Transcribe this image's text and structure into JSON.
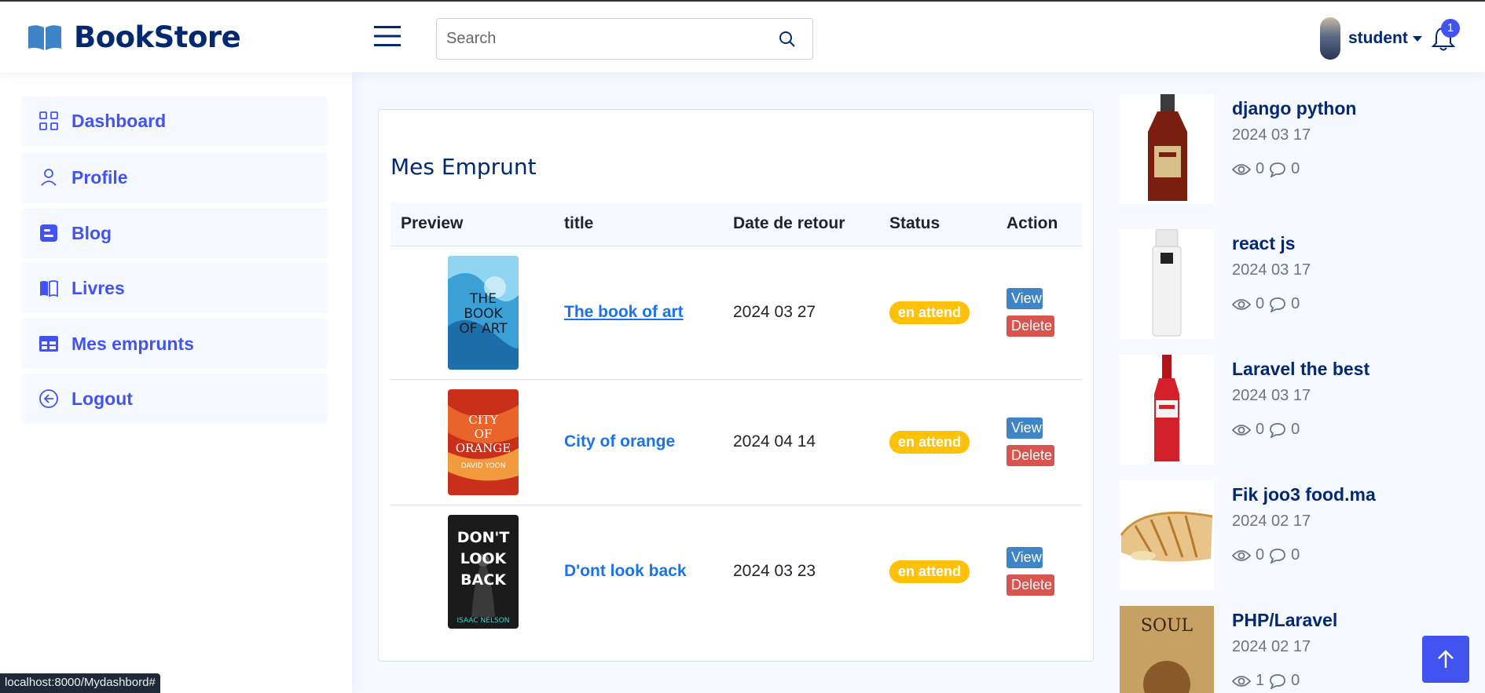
{
  "header": {
    "brand": "BookStore",
    "search_placeholder": "Search",
    "user_name": "student",
    "notification_count": "1"
  },
  "sidebar": {
    "items": [
      {
        "label": "Dashboard",
        "icon": "grid-icon"
      },
      {
        "label": "Profile",
        "icon": "person-icon"
      },
      {
        "label": "Blog",
        "icon": "blogger-icon"
      },
      {
        "label": "Livres",
        "icon": "book-icon"
      },
      {
        "label": "Mes emprunts",
        "icon": "table-icon"
      },
      {
        "label": "Logout",
        "icon": "arrow-left-circle-icon"
      }
    ]
  },
  "loans": {
    "title": "Mes Emprunt",
    "columns": [
      "Preview",
      "title",
      "Date de retour",
      "Status",
      "Action"
    ],
    "rows": [
      {
        "title": "The book of art",
        "date": "2024 03 27",
        "status": "en attend",
        "view": "View",
        "delete": "Delete",
        "cover_text": [
          "THE",
          "BOOK",
          "OF ART"
        ]
      },
      {
        "title": "City of orange",
        "date": "2024 04 14",
        "status": "en attend",
        "view": "View",
        "delete": "Delete",
        "cover_text": [
          "CITY",
          "OF",
          "ORANGE",
          "DAVID YOON"
        ]
      },
      {
        "title": "D'ont look back",
        "date": "2024 03 23",
        "status": "en attend",
        "view": "View",
        "delete": "Delete",
        "cover_text": [
          "DON'T",
          "LOOK",
          "BACK",
          "ISAAC NELSON"
        ]
      }
    ]
  },
  "recent_posts": [
    {
      "title": "django python",
      "date": "2024 03 17",
      "views": "0",
      "comments": "0"
    },
    {
      "title": "react js",
      "date": "2024 03 17",
      "views": "0",
      "comments": "0"
    },
    {
      "title": "Laravel the best",
      "date": "2024 03 17",
      "views": "0",
      "comments": "0"
    },
    {
      "title": "Fik joo3 food.ma",
      "date": "2024 02 17",
      "views": "0",
      "comments": "0"
    },
    {
      "title": "PHP/Laravel",
      "date": "2024 02 17",
      "views": "1",
      "comments": "0",
      "cover_text": "SOUL"
    }
  ],
  "status_url": "localhost:8000/Mydashbord#",
  "colors": {
    "primary": "#4154f1",
    "navy": "#012970",
    "badge": "#ffc107",
    "view": "#3d85c6",
    "delete": "#d9534f"
  }
}
